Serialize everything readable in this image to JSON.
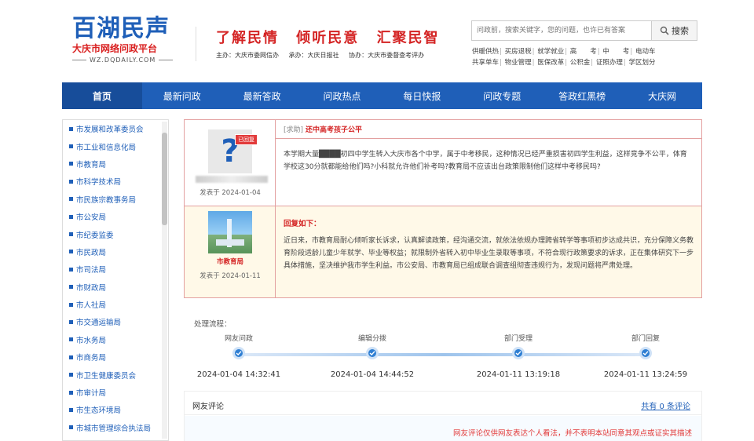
{
  "logo": {
    "main": "百湖民声",
    "sub": "大庆市网络问政平台",
    "url": "WZ.DQDAILY.COM"
  },
  "slogan": [
    "了解民情",
    "倾听民意",
    "汇聚民智"
  ],
  "organizers": [
    "主办：大庆市委网信办",
    "承办：大庆日报社",
    "协办：大庆市委督查考评办"
  ],
  "search": {
    "placeholder": "问政前，搜索关键字，您的问题，也许已有答案",
    "button": "搜索"
  },
  "quick_links": {
    "row1": [
      "供暖供热",
      "买房退税",
      "就学就业",
      "高　　考",
      "中　　考",
      "电动车"
    ],
    "row2": [
      "共享单车",
      "物业管理",
      "医保改革",
      "公积金",
      "证照办理",
      "学区划分"
    ]
  },
  "nav": [
    "首页",
    "最新问政",
    "最新答政",
    "问政热点",
    "每日快报",
    "问政专题",
    "答政红黑榜",
    "大庆网"
  ],
  "sidebar": [
    "市发展和改革委员会",
    "市工业和信息化局",
    "市教育局",
    "市科学技术局",
    "市民族宗教事务局",
    "市公安局",
    "市纪委监委",
    "市民政局",
    "市司法局",
    "市财政局",
    "市人社局",
    "市交通运输局",
    "市水务局",
    "市商务局",
    "市卫生健康委员会",
    "市审计局",
    "市生态环境局",
    "市城市管理综合执法局"
  ],
  "question": {
    "badge": "已回复",
    "date": "发表于 2024-01-04",
    "tag": "[求助]",
    "title": "还中高考孩子公平",
    "body": "本学期大量████初四中学生转入大庆市各个中学，属于中考移民，这种情况已经严重损害初四学生利益，这样竞争不公平，体育学校这30分就都能给他们吗?小科就允许他们补考吗?教育局不应该出台政策限制他们这样中考移民吗?"
  },
  "answer": {
    "name": "市教育局",
    "date": "发表于 2024-01-11",
    "head": "回复如下：",
    "body": "近日来，市教育局耐心倾听家长诉求，认真解读政策，经沟通交流，就依法依规办理跨省转学等事项初步达成共识，充分保障义务教育阶段适龄儿童少年就学、毕业等权益；就限制外省转入初中毕业生录取等事项，不符合现行政策要求的诉求，正在集体研究下一步具体措施，坚决维护我市学生利益。市公安局、市教育局已组成联合调查组彻查违规行为，发现问题将严肃处理。"
  },
  "process": {
    "label": "处理流程：",
    "steps": [
      {
        "label": "网友问政",
        "time": "2024-01-04 14:32:41"
      },
      {
        "label": "编辑分拨",
        "time": "2024-01-04 14:44:52"
      },
      {
        "label": "部门受理",
        "time": "2024-01-11 13:19:18"
      },
      {
        "label": "部门回复",
        "time": "2024-01-11 13:24:59"
      }
    ]
  },
  "comments": {
    "title": "网友评论",
    "count_prefix": "共有",
    "count": "0",
    "count_suffix": "条评论",
    "disclaimer": "网友评论仅供网友表达个人看法，并不表明本站同意其观点或证实其描述"
  },
  "colors": {
    "brand_blue": "#1f5fb8",
    "accent_red": "#d42424"
  }
}
